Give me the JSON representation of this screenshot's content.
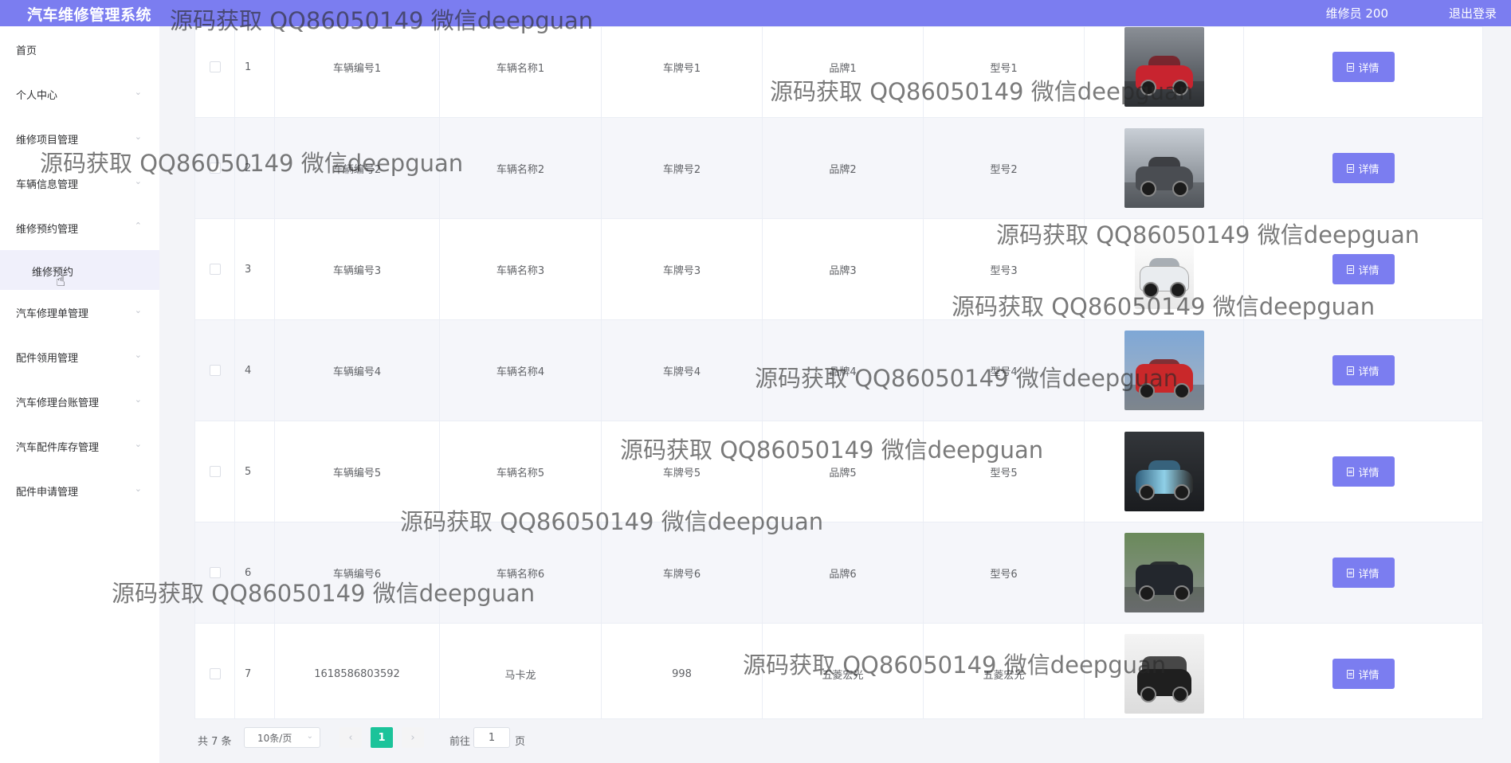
{
  "header": {
    "title": "汽车维修管理系统",
    "user": "维修员 200",
    "logout": "退出登录",
    "bg_color": "#7b7df0"
  },
  "sidebar": {
    "items": [
      {
        "label": "首页",
        "has_arrow": false
      },
      {
        "label": "个人中心",
        "has_arrow": true
      },
      {
        "label": "维修项目管理",
        "has_arrow": true
      },
      {
        "label": "车辆信息管理",
        "has_arrow": true
      },
      {
        "label": "维修预约管理",
        "has_arrow": true,
        "expanded": true
      },
      {
        "label": "维修预约",
        "sub": true
      },
      {
        "label": "汽车修理单管理",
        "has_arrow": true
      },
      {
        "label": "配件领用管理",
        "has_arrow": true
      },
      {
        "label": "汽车修理台账管理",
        "has_arrow": true
      },
      {
        "label": "汽车配件库存管理",
        "has_arrow": true
      },
      {
        "label": "配件申请管理",
        "has_arrow": true
      }
    ],
    "arrow_down": "⌄",
    "arrow_up": "⌃"
  },
  "table": {
    "detail_label": "详情",
    "rows": [
      {
        "index": "1",
        "code": "车辆编号1",
        "name": "车辆名称1",
        "plate": "车牌号1",
        "brand": "品牌1",
        "model": "型号1",
        "image": "red-sports-car"
      },
      {
        "index": "2",
        "code": "车辆编号2",
        "name": "车辆名称2",
        "plate": "车牌号2",
        "brand": "品牌2",
        "model": "型号2",
        "image": "grey-muscle-car"
      },
      {
        "index": "3",
        "code": "车辆编号3",
        "name": "车辆名称3",
        "plate": "车牌号3",
        "brand": "品牌3",
        "model": "型号3",
        "image": "white-suv"
      },
      {
        "index": "4",
        "code": "车辆编号4",
        "name": "车辆名称4",
        "plate": "车牌号4",
        "brand": "品牌4",
        "model": "型号4",
        "image": "red-suv"
      },
      {
        "index": "5",
        "code": "车辆编号5",
        "name": "车辆名称5",
        "plate": "车牌号5",
        "brand": "品牌5",
        "model": "型号5",
        "image": "wrapped-car"
      },
      {
        "index": "6",
        "code": "车辆编号6",
        "name": "车辆名称6",
        "plate": "车牌号6",
        "brand": "品牌6",
        "model": "型号6",
        "image": "black-suv"
      },
      {
        "index": "7",
        "code": "1618586803592",
        "name": "马卡龙",
        "plate": "998",
        "brand": "五菱宏光",
        "model": "五菱宏光",
        "image": "black-mini-car"
      }
    ]
  },
  "pagination": {
    "total": "共 7 条",
    "page_size": "10条/页",
    "prev": "‹",
    "current": "1",
    "next": "›",
    "goto": "前往",
    "goto_value": "1",
    "unit": "页",
    "active_color": "#1bc39a"
  },
  "watermark": "源码获取 QQ86050149 微信deepguan"
}
